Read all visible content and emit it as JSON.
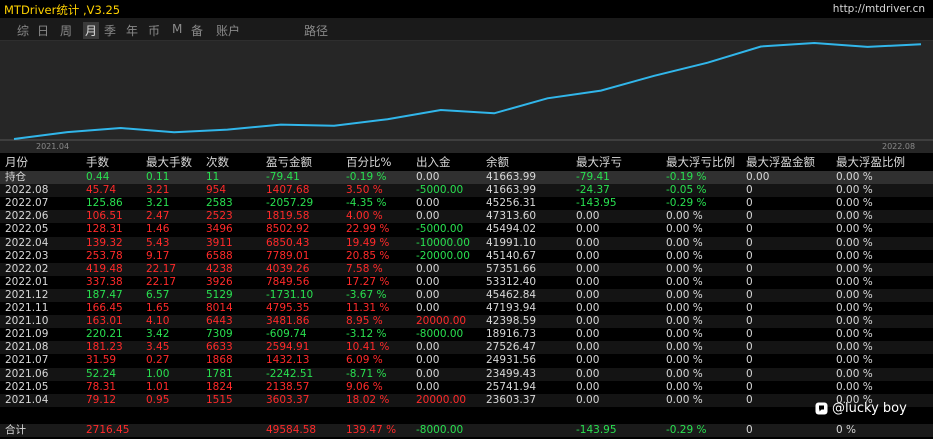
{
  "app": {
    "title": "MTDriver统计 ,V3.25",
    "link": "http://mtdriver.cn"
  },
  "tabs": [
    {
      "label": "综",
      "active": false
    },
    {
      "label": "日",
      "active": false
    },
    {
      "label": "周",
      "active": false
    },
    {
      "label": "月",
      "active": true
    },
    {
      "label": "季",
      "active": false
    },
    {
      "label": "年",
      "active": false
    },
    {
      "label": "币",
      "active": false
    },
    {
      "label": "M",
      "active": false
    },
    {
      "label": "备",
      "active": false
    },
    {
      "label": "账户",
      "active": false
    },
    {
      "label": "路径",
      "active": false
    }
  ],
  "chart": {
    "start_label": "2021.04",
    "end_label": "2022.08",
    "line_color": "#31b6ea",
    "balance": [
      23603.37,
      25741.94,
      23499.43,
      24931.56,
      27526.47,
      18916.73,
      42398.59,
      47193.94,
      45462.84,
      53312.4,
      57351.66,
      45140.67,
      41991.1,
      45494.02,
      47313.6,
      45256.31,
      41663.99,
      41663.99
    ]
  },
  "table": {
    "columns": [
      "月份",
      "手数",
      "最大手数",
      "次数",
      "盈亏金额",
      "百分比%",
      "出入金",
      "余额",
      "最大浮亏",
      "最大浮亏比例",
      "最大浮盈金额",
      "最大浮盈比例"
    ],
    "rows": [
      [
        "持仓",
        "0.44",
        "0.11",
        "11",
        "-79.41",
        "-0.19 %",
        "0.00",
        "41663.99",
        "-79.41",
        "-0.19 %",
        "0.00",
        "0.00 %"
      ],
      [
        "2022.08",
        "45.74",
        "3.21",
        "954",
        "1407.68",
        "3.50 %",
        "-5000.00",
        "41663.99",
        "-24.37",
        "-0.05 %",
        "0",
        "0.00 %"
      ],
      [
        "2022.07",
        "125.86",
        "3.21",
        "2583",
        "-2057.29",
        "-4.35 %",
        "0.00",
        "45256.31",
        "-143.95",
        "-0.29 %",
        "0",
        "0.00 %"
      ],
      [
        "2022.06",
        "106.51",
        "2.47",
        "2523",
        "1819.58",
        "4.00 %",
        "0.00",
        "47313.60",
        "0.00",
        "0.00 %",
        "0",
        "0.00 %"
      ],
      [
        "2022.05",
        "128.31",
        "1.46",
        "3496",
        "8502.92",
        "22.99 %",
        "-5000.00",
        "45494.02",
        "0.00",
        "0.00 %",
        "0",
        "0.00 %"
      ],
      [
        "2022.04",
        "139.32",
        "5.43",
        "3911",
        "6850.43",
        "19.49 %",
        "-10000.00",
        "41991.10",
        "0.00",
        "0.00 %",
        "0",
        "0.00 %"
      ],
      [
        "2022.03",
        "253.78",
        "9.17",
        "6588",
        "7789.01",
        "20.85 %",
        "-20000.00",
        "45140.67",
        "0.00",
        "0.00 %",
        "0",
        "0.00 %"
      ],
      [
        "2022.02",
        "419.48",
        "22.17",
        "4238",
        "4039.26",
        "7.58 %",
        "0.00",
        "57351.66",
        "0.00",
        "0.00 %",
        "0",
        "0.00 %"
      ],
      [
        "2022.01",
        "337.38",
        "22.17",
        "3926",
        "7849.56",
        "17.27 %",
        "0.00",
        "53312.40",
        "0.00",
        "0.00 %",
        "0",
        "0.00 %"
      ],
      [
        "2021.12",
        "187.47",
        "6.57",
        "5129",
        "-1731.10",
        "-3.67 %",
        "0.00",
        "45462.84",
        "0.00",
        "0.00 %",
        "0",
        "0.00 %"
      ],
      [
        "2021.11",
        "166.45",
        "1.65",
        "8014",
        "4795.35",
        "11.31 %",
        "0.00",
        "47193.94",
        "0.00",
        "0.00 %",
        "0",
        "0.00 %"
      ],
      [
        "2021.10",
        "163.01",
        "4.10",
        "6443",
        "3481.86",
        "8.95 %",
        "20000.00",
        "42398.59",
        "0.00",
        "0.00 %",
        "0",
        "0.00 %"
      ],
      [
        "2021.09",
        "220.21",
        "3.42",
        "7309",
        "-609.74",
        "-3.12 %",
        "-8000.00",
        "18916.73",
        "0.00",
        "0.00 %",
        "0",
        "0.00 %"
      ],
      [
        "2021.08",
        "181.23",
        "3.45",
        "6633",
        "2594.91",
        "10.41 %",
        "0.00",
        "27526.47",
        "0.00",
        "0.00 %",
        "0",
        "0.00 %"
      ],
      [
        "2021.07",
        "31.59",
        "0.27",
        "1868",
        "1432.13",
        "6.09 %",
        "0.00",
        "24931.56",
        "0.00",
        "0.00 %",
        "0",
        "0.00 %"
      ],
      [
        "2021.06",
        "52.24",
        "1.00",
        "1781",
        "-2242.51",
        "-8.71 %",
        "0.00",
        "23499.43",
        "0.00",
        "0.00 %",
        "0",
        "0.00 %"
      ],
      [
        "2021.05",
        "78.31",
        "1.01",
        "1824",
        "2138.57",
        "9.06 %",
        "0.00",
        "25741.94",
        "0.00",
        "0.00 %",
        "0",
        "0.00 %"
      ],
      [
        "2021.04",
        "79.12",
        "0.95",
        "1515",
        "3603.37",
        "18.02 %",
        "20000.00",
        "23603.37",
        "0.00",
        "0.00 %",
        "0",
        "0.00 %"
      ]
    ],
    "total": [
      "合计",
      "2716.45",
      "",
      "",
      "49584.58",
      "139.47 %",
      "-8000.00",
      "",
      "-143.95",
      "-0.29 %",
      "0",
      "0 %"
    ]
  },
  "watermark": {
    "text": "@lucky boy",
    "icon": "chat-bubble-icon"
  }
}
